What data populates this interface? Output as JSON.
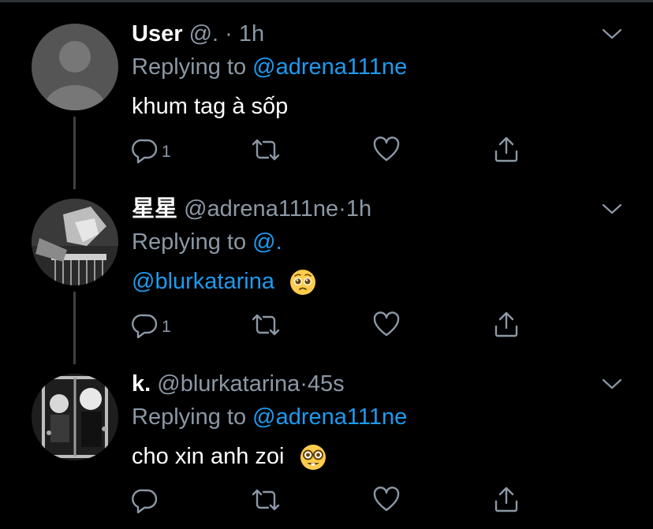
{
  "colors": {
    "background": "#000000",
    "accent": "#1d9bf0",
    "secondary_text": "#8b98a5",
    "primary_text": "#ffffff"
  },
  "tweets": [
    {
      "display_name": "User",
      "handle": "@.",
      "separator": "·",
      "time": "1h",
      "replying_prefix": "Replying to",
      "replying_to": "@adrena111ne",
      "text": "khum tag à sốp",
      "text_mention": "",
      "emoji": "",
      "reply_count": "1",
      "icons": [
        "reply-icon",
        "retweet-icon",
        "like-icon",
        "share-icon",
        "chevron-down-icon"
      ]
    },
    {
      "display_name": "星星",
      "handle": "@adrena111ne",
      "separator": "·",
      "time": "1h",
      "replying_prefix": "Replying to",
      "replying_to": "@.",
      "text": "",
      "text_mention": "@blurkatarina",
      "emoji": "pleading-face-emoji",
      "reply_count": "1",
      "icons": [
        "reply-icon",
        "retweet-icon",
        "like-icon",
        "share-icon",
        "chevron-down-icon"
      ]
    },
    {
      "display_name": "k.",
      "handle": "@blurkatarina",
      "separator": "·",
      "time": "45s",
      "replying_prefix": "Replying to",
      "replying_to": "@adrena111ne",
      "text": "cho xin anh zoi",
      "text_mention": "",
      "emoji": "nerd-face-emoji",
      "reply_count": "",
      "icons": [
        "reply-icon",
        "retweet-icon",
        "like-icon",
        "share-icon",
        "chevron-down-icon"
      ]
    }
  ]
}
